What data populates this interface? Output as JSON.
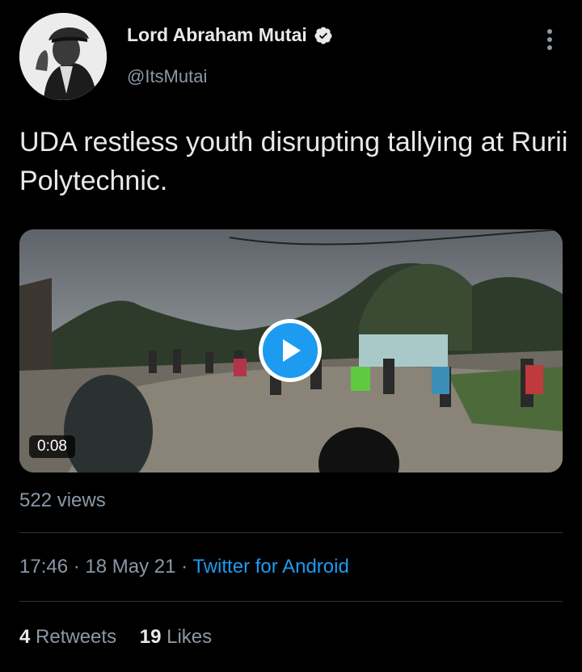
{
  "user": {
    "display_name": "Lord Abraham Mutai",
    "handle": "@ItsMutai",
    "verified": true
  },
  "icons": {
    "verified": "verified-badge-icon",
    "more": "more-vertical-icon",
    "play": "play-icon"
  },
  "tweet": {
    "text": "UDA restless youth disrupting tallying at Rurii Polytechnic."
  },
  "media": {
    "duration": "0:08"
  },
  "views": "522 views",
  "meta": {
    "time": "17:46",
    "separator": "·",
    "date": "18 May 21",
    "source": "Twitter for Android"
  },
  "stats": {
    "retweets_count": "4",
    "retweets_label": "Retweets",
    "likes_count": "19",
    "likes_label": "Likes"
  },
  "colors": {
    "background": "#000000",
    "accent": "#1d9bf0",
    "secondary_text": "#8b98a5",
    "divider": "#2f3336"
  }
}
